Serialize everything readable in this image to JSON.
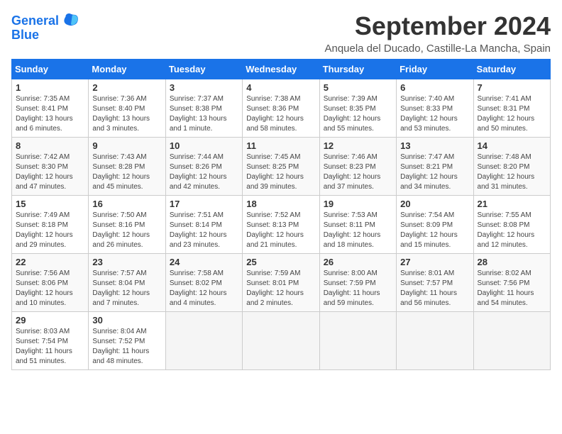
{
  "logo": {
    "line1": "General",
    "line2": "Blue"
  },
  "title": "September 2024",
  "subtitle": "Anquela del Ducado, Castille-La Mancha, Spain",
  "weekdays": [
    "Sunday",
    "Monday",
    "Tuesday",
    "Wednesday",
    "Thursday",
    "Friday",
    "Saturday"
  ],
  "weeks": [
    [
      {
        "day": "1",
        "info": "Sunrise: 7:35 AM\nSunset: 8:41 PM\nDaylight: 13 hours\nand 6 minutes."
      },
      {
        "day": "2",
        "info": "Sunrise: 7:36 AM\nSunset: 8:40 PM\nDaylight: 13 hours\nand 3 minutes."
      },
      {
        "day": "3",
        "info": "Sunrise: 7:37 AM\nSunset: 8:38 PM\nDaylight: 13 hours\nand 1 minute."
      },
      {
        "day": "4",
        "info": "Sunrise: 7:38 AM\nSunset: 8:36 PM\nDaylight: 12 hours\nand 58 minutes."
      },
      {
        "day": "5",
        "info": "Sunrise: 7:39 AM\nSunset: 8:35 PM\nDaylight: 12 hours\nand 55 minutes."
      },
      {
        "day": "6",
        "info": "Sunrise: 7:40 AM\nSunset: 8:33 PM\nDaylight: 12 hours\nand 53 minutes."
      },
      {
        "day": "7",
        "info": "Sunrise: 7:41 AM\nSunset: 8:31 PM\nDaylight: 12 hours\nand 50 minutes."
      }
    ],
    [
      {
        "day": "8",
        "info": "Sunrise: 7:42 AM\nSunset: 8:30 PM\nDaylight: 12 hours\nand 47 minutes."
      },
      {
        "day": "9",
        "info": "Sunrise: 7:43 AM\nSunset: 8:28 PM\nDaylight: 12 hours\nand 45 minutes."
      },
      {
        "day": "10",
        "info": "Sunrise: 7:44 AM\nSunset: 8:26 PM\nDaylight: 12 hours\nand 42 minutes."
      },
      {
        "day": "11",
        "info": "Sunrise: 7:45 AM\nSunset: 8:25 PM\nDaylight: 12 hours\nand 39 minutes."
      },
      {
        "day": "12",
        "info": "Sunrise: 7:46 AM\nSunset: 8:23 PM\nDaylight: 12 hours\nand 37 minutes."
      },
      {
        "day": "13",
        "info": "Sunrise: 7:47 AM\nSunset: 8:21 PM\nDaylight: 12 hours\nand 34 minutes."
      },
      {
        "day": "14",
        "info": "Sunrise: 7:48 AM\nSunset: 8:20 PM\nDaylight: 12 hours\nand 31 minutes."
      }
    ],
    [
      {
        "day": "15",
        "info": "Sunrise: 7:49 AM\nSunset: 8:18 PM\nDaylight: 12 hours\nand 29 minutes."
      },
      {
        "day": "16",
        "info": "Sunrise: 7:50 AM\nSunset: 8:16 PM\nDaylight: 12 hours\nand 26 minutes."
      },
      {
        "day": "17",
        "info": "Sunrise: 7:51 AM\nSunset: 8:14 PM\nDaylight: 12 hours\nand 23 minutes."
      },
      {
        "day": "18",
        "info": "Sunrise: 7:52 AM\nSunset: 8:13 PM\nDaylight: 12 hours\nand 21 minutes."
      },
      {
        "day": "19",
        "info": "Sunrise: 7:53 AM\nSunset: 8:11 PM\nDaylight: 12 hours\nand 18 minutes."
      },
      {
        "day": "20",
        "info": "Sunrise: 7:54 AM\nSunset: 8:09 PM\nDaylight: 12 hours\nand 15 minutes."
      },
      {
        "day": "21",
        "info": "Sunrise: 7:55 AM\nSunset: 8:08 PM\nDaylight: 12 hours\nand 12 minutes."
      }
    ],
    [
      {
        "day": "22",
        "info": "Sunrise: 7:56 AM\nSunset: 8:06 PM\nDaylight: 12 hours\nand 10 minutes."
      },
      {
        "day": "23",
        "info": "Sunrise: 7:57 AM\nSunset: 8:04 PM\nDaylight: 12 hours\nand 7 minutes."
      },
      {
        "day": "24",
        "info": "Sunrise: 7:58 AM\nSunset: 8:02 PM\nDaylight: 12 hours\nand 4 minutes."
      },
      {
        "day": "25",
        "info": "Sunrise: 7:59 AM\nSunset: 8:01 PM\nDaylight: 12 hours\nand 2 minutes."
      },
      {
        "day": "26",
        "info": "Sunrise: 8:00 AM\nSunset: 7:59 PM\nDaylight: 11 hours\nand 59 minutes."
      },
      {
        "day": "27",
        "info": "Sunrise: 8:01 AM\nSunset: 7:57 PM\nDaylight: 11 hours\nand 56 minutes."
      },
      {
        "day": "28",
        "info": "Sunrise: 8:02 AM\nSunset: 7:56 PM\nDaylight: 11 hours\nand 54 minutes."
      }
    ],
    [
      {
        "day": "29",
        "info": "Sunrise: 8:03 AM\nSunset: 7:54 PM\nDaylight: 11 hours\nand 51 minutes."
      },
      {
        "day": "30",
        "info": "Sunrise: 8:04 AM\nSunset: 7:52 PM\nDaylight: 11 hours\nand 48 minutes."
      },
      {
        "day": "",
        "info": ""
      },
      {
        "day": "",
        "info": ""
      },
      {
        "day": "",
        "info": ""
      },
      {
        "day": "",
        "info": ""
      },
      {
        "day": "",
        "info": ""
      }
    ]
  ]
}
